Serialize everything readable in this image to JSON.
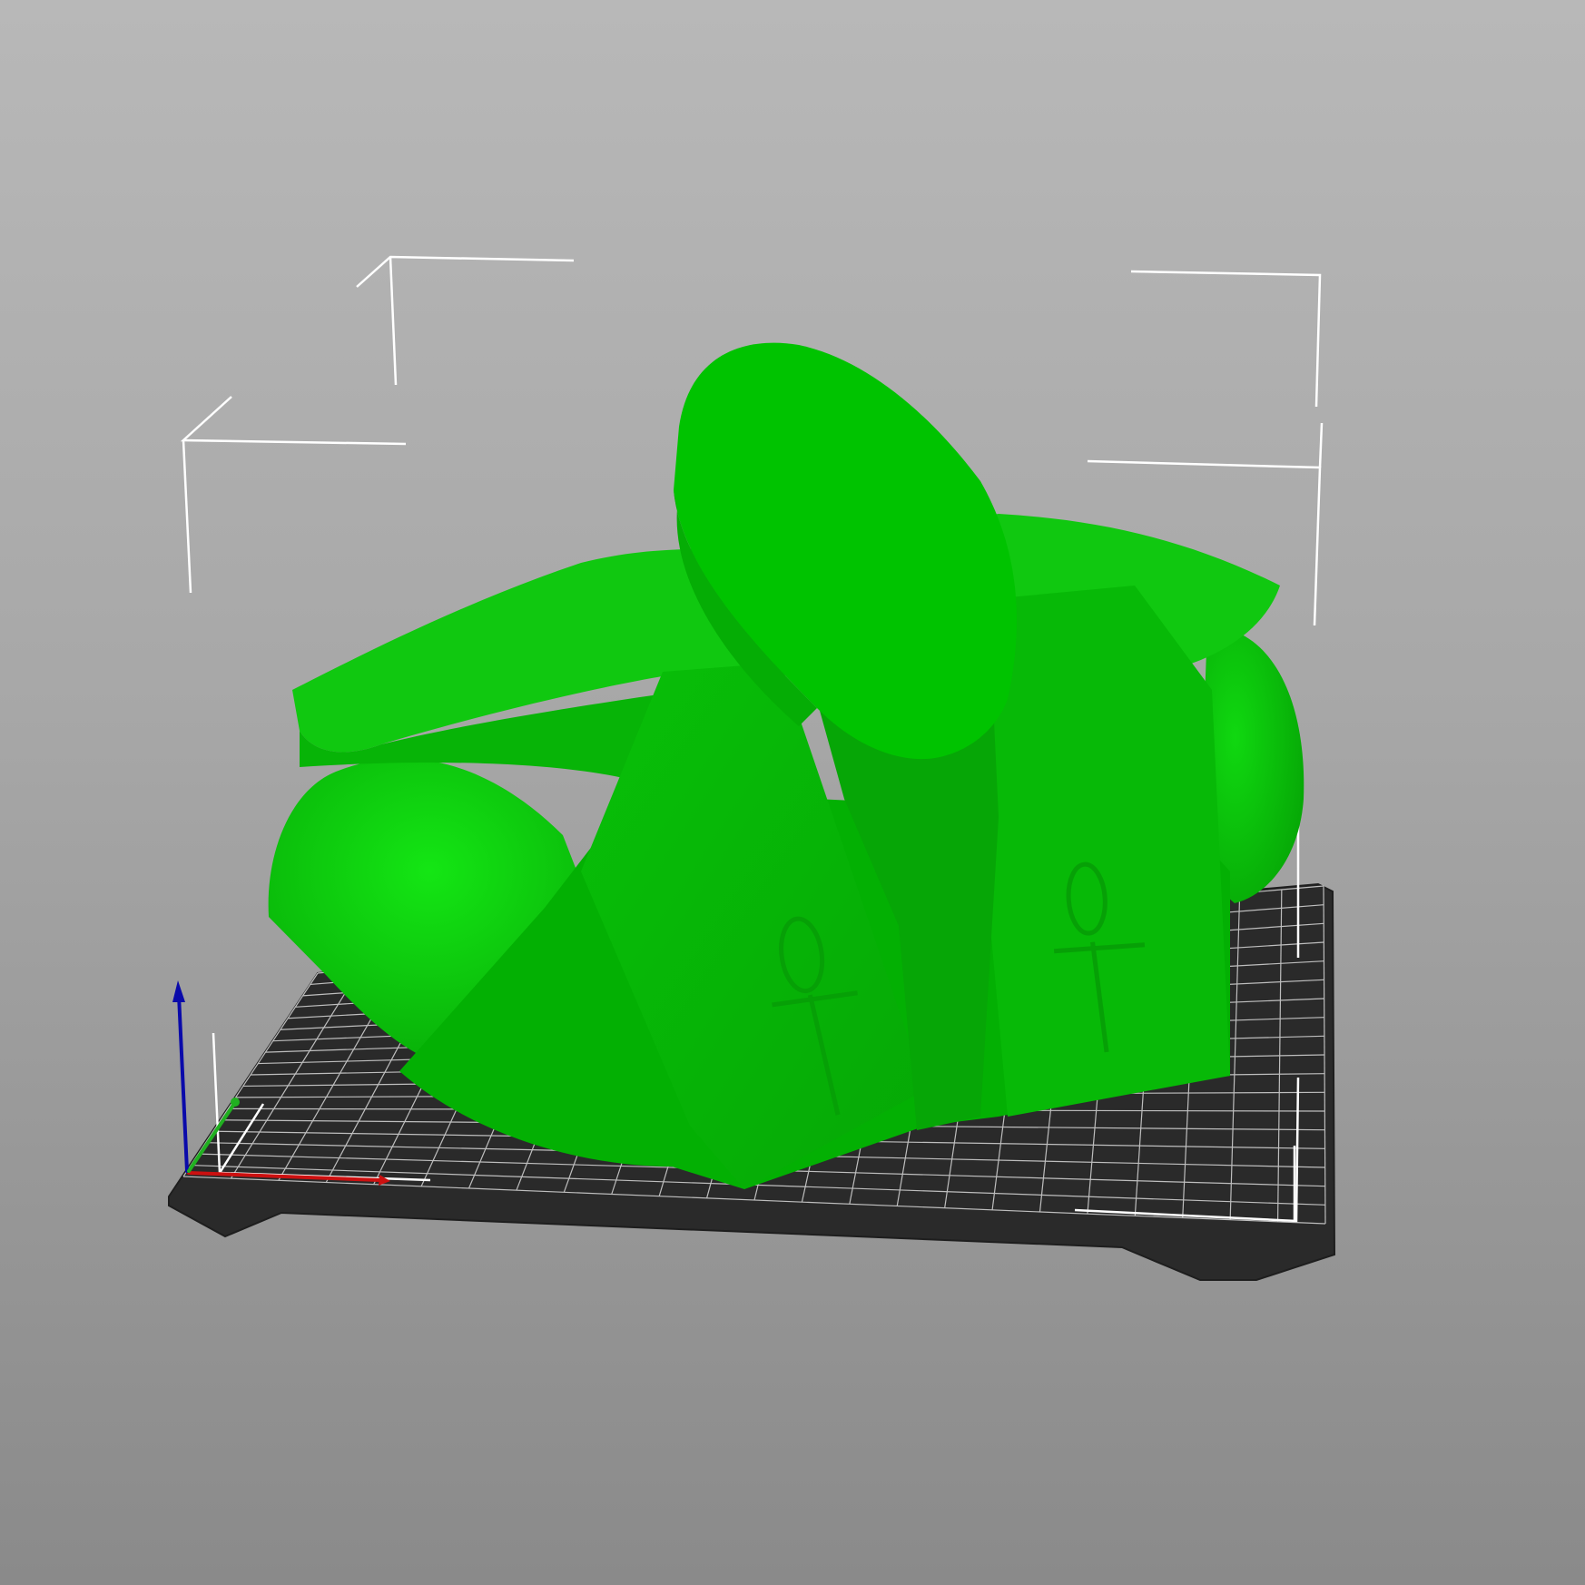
{
  "viewport": {
    "background_top": "#b8b8b8",
    "background_bottom": "#8a8a8a"
  },
  "bed": {
    "plate_color": "#2a2a2a",
    "grid_color": "#d8d8d8"
  },
  "model": {
    "color": "#00c800",
    "highlight_color": "#14e614",
    "embossed_symbols": [
      "ankh-icon",
      "ankh-icon"
    ]
  },
  "axes": {
    "x_color": "#cc1010",
    "y_color": "#20b020",
    "z_color": "#0a0aaa"
  },
  "bounding_box": {
    "color": "#ffffff"
  }
}
